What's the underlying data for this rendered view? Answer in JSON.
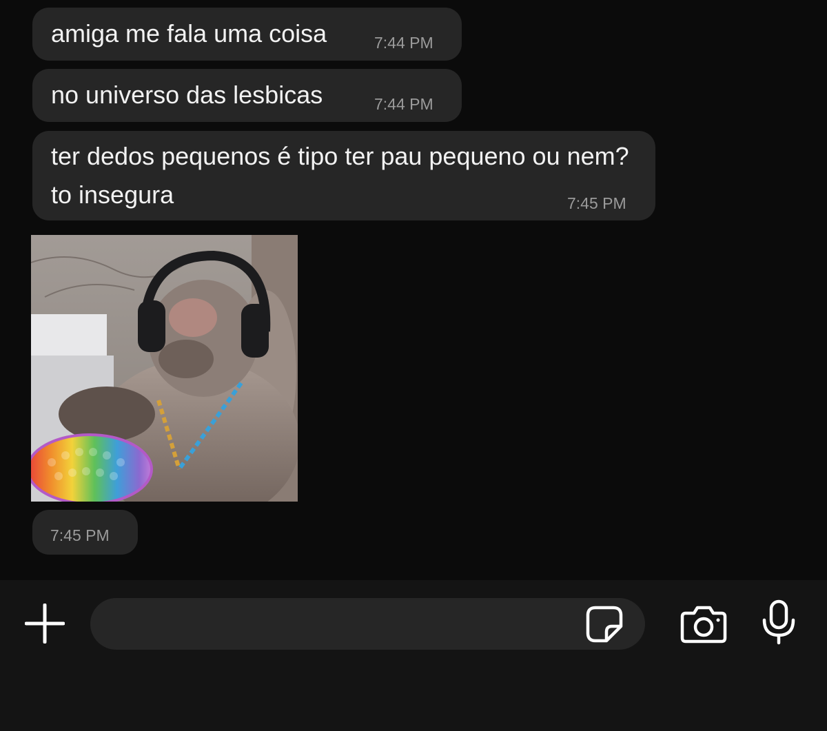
{
  "messages": [
    {
      "text": "amiga me fala uma coisa",
      "time": "7:44 PM"
    },
    {
      "text": "no universo das lesbicas",
      "time": "7:44 PM"
    },
    {
      "text": "ter dedos pequenos é tipo ter pau pequeno ou nem? to insegura",
      "time": "7:45 PM"
    },
    {
      "media": "photo-monkey-with-headphones-and-rainbow-pop-it",
      "time": "7:45 PM"
    }
  ],
  "input": {
    "value": "",
    "placeholder": ""
  },
  "icons": {
    "add": "plus-icon",
    "sticker": "sticker-icon",
    "camera": "camera-icon",
    "microphone": "microphone-icon"
  },
  "colors": {
    "background": "#0b0b0b",
    "bubble": "#262626",
    "timestamp": "#9b9b9b",
    "input_bar": "#141414"
  }
}
